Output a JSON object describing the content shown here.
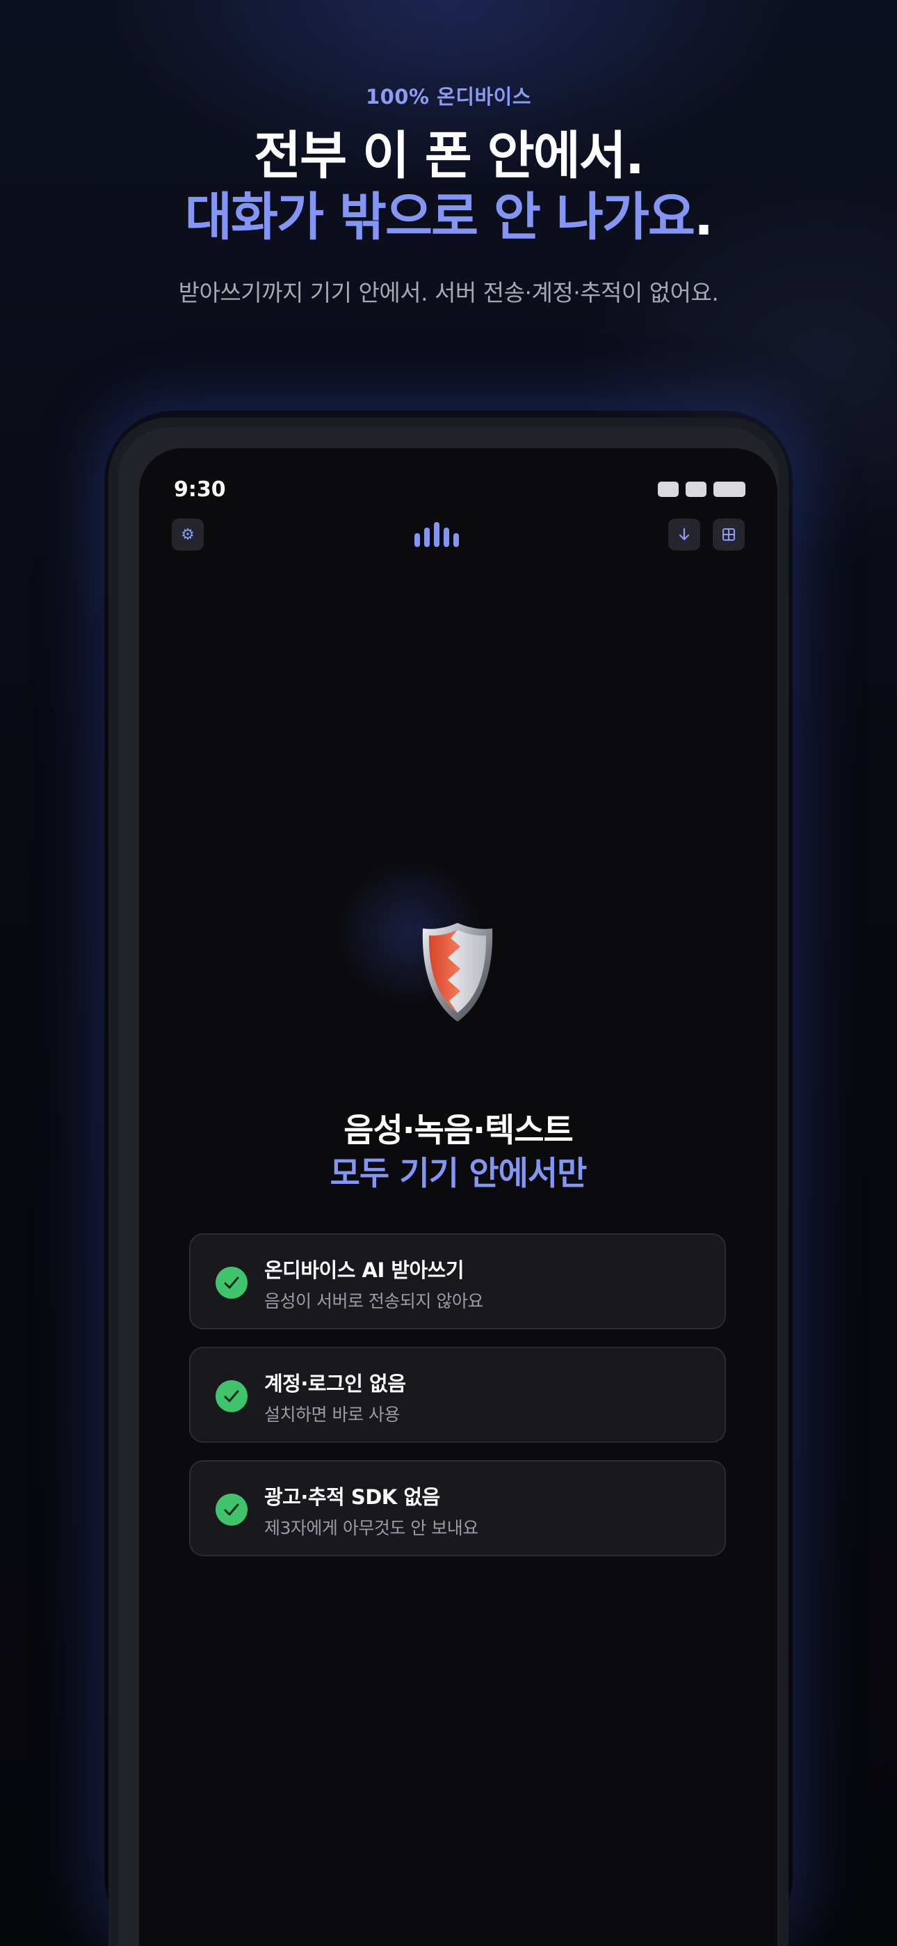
{
  "header": {
    "eyebrow": "100% 온디바이스",
    "headline_line1": "전부 이 폰 안에서.",
    "headline_line2": "대화가 밖으로 안 나가요",
    "headline_line2_end": ".",
    "subcopy": "받아쓰기까지 기기 안에서. 서버 전송·계정·추적이 없어요."
  },
  "status_bar": {
    "time": "9:30"
  },
  "toolbar": {
    "settings_icon": "gear-icon",
    "download_icon": "arrow-down-icon",
    "grid_icon": "grid-icon",
    "logo_icon": "audio-bars-icon"
  },
  "hero": {
    "icon": "shield-icon",
    "title_line1": "음성·녹음·텍스트",
    "title_line2": "모두 기기 안에서만"
  },
  "features": [
    {
      "title": "온디바이스 AI 받아쓰기",
      "desc": "음성이 서버로 전송되지 않아요",
      "icon": "check-icon"
    },
    {
      "title": "계정·로그인 없음",
      "desc": "설치하면 바로 사용",
      "icon": "check-icon"
    },
    {
      "title": "광고·추적 SDK 없음",
      "desc": "제3자에게 아무것도 안 보내요",
      "icon": "check-icon"
    }
  ],
  "colors": {
    "accent": "#8496f5",
    "check": "#3fc46b",
    "background": "#07080c",
    "card": "#18181d"
  }
}
